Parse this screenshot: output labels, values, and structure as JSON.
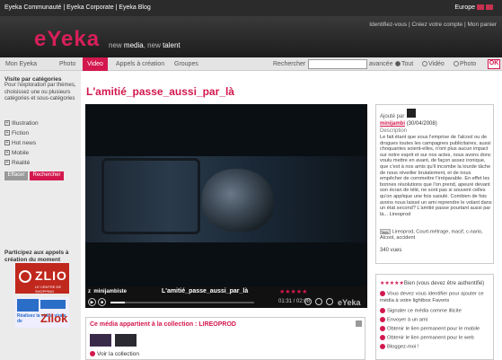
{
  "topbar": {
    "links": "Eyeka Communauté | Eyeka Corporate | Eyeka Blog",
    "region": "Europe"
  },
  "header": {
    "logo": "eYeka",
    "tag_1": "new",
    "tag_2": "media",
    "tag_3": ", new",
    "tag_4": "talent",
    "user_links": "Identifiez-vous | Créez votre compte | Mon panier"
  },
  "nav": {
    "items": [
      "Mon Eyeka",
      "Photo",
      "Video",
      "Appels à création",
      "Groupes"
    ],
    "search_label": "Rechercher",
    "avancee": "avancée",
    "options": [
      "Tout",
      "Vidéo",
      "Photo"
    ],
    "ok": "OK"
  },
  "left": {
    "title": "Visite par catégories",
    "desc": "Pour l'exploration par thèmes, choisissez une ou plusieurs catégories et sous-catégories",
    "categories": [
      "Illustration",
      "Fiction",
      "Hot news",
      "Mobile",
      "Réalité"
    ],
    "btn_clear": "Effacer",
    "btn_search": "Rechercher",
    "participate": "Participez aux appels à création du moment",
    "zlio_logo": "ZLIO",
    "zlio_sub": "LE CENTRE DE SHOPPING",
    "zilok_text": "Réalisez la vidéo virale de",
    "zilok_logo": "Zilok"
  },
  "main": {
    "title": "L'amitié_passe_aussi_par_là",
    "video_user": "minijambiste",
    "video_name": "L'amitié_passe_aussi_par_là",
    "video_stars": "★★★★★",
    "time": "01:31 / 02:08",
    "brand": "eYeka",
    "collection_title": "Ce média appartient à la collection : LIREOPROD",
    "voir": "Voir la collection"
  },
  "info": {
    "ajoute": "Ajouté par",
    "par_user": "minijambi",
    "par_date": "(30/04/2008)",
    "desc_label": "Description",
    "desc": "Le fait étant que sous l'emprise de l'alcool ou de drogues toutes les campagnes publicitaires, aussi choquantes soient-elles, n'ont plus aucun impact sur notre esprit et sur nos actes, nous avons donc voulu mettre en avant, de façon assez ironique, que c'est à nos amis qu'il incombe la lourde tâche de nous réveiller brutalement, et de nous empêcher de commettre l'irréparable. En effet les bonnes résolutions que l'on prend, apeuré devant son écran de télé, ne sont pas si souvent celles qu'on applique une fois saoulé. Combien de fois avons nous laissé un ami reprendre le volant dans un état second? L'amitié passe pourtant aussi par là... Lireoprod",
    "tags_icon": "Tags",
    "tags": "Lireoprod, Court-métrage, macif, c-nario, Alcool, accident",
    "vues": "340 vues"
  },
  "actions": {
    "stars": "★★★★★",
    "rating": "Bien (vous devez être authentifié)",
    "msg": "Vous devez vous identifier pour ajouter ce média à votre lightbox Favoris",
    "items": [
      "Signaler ce média comme illicite",
      "Envoyer à un ami",
      "Obtenir le lien permanent pour le mobile",
      "Obtenir le lien permanent pour le web",
      "Bloggez-moi !"
    ]
  },
  "colors": {
    "accent": "#d3184e",
    "dark": "#2b2b2b"
  }
}
